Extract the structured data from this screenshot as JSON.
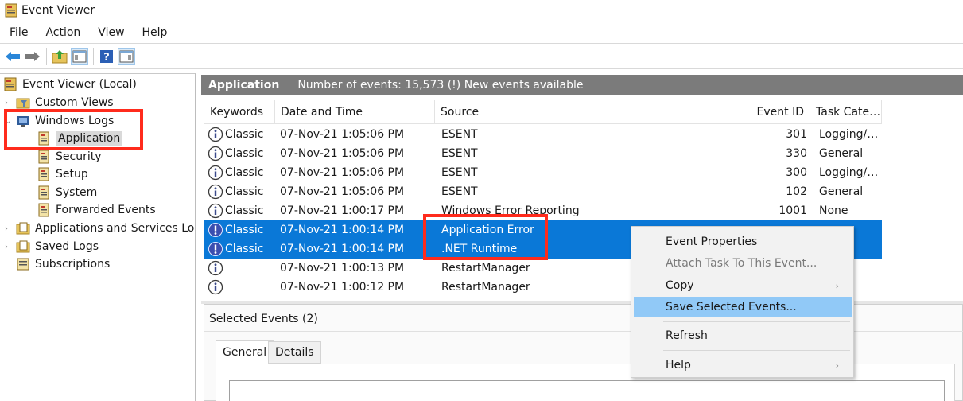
{
  "window": {
    "title": "Event Viewer"
  },
  "menu": [
    "File",
    "Action",
    "View",
    "Help"
  ],
  "toolbar": {
    "buttons": [
      "back-arrow-icon",
      "forward-arrow-icon",
      "folder-up-icon",
      "show-hide-console-tree-icon",
      "help-icon",
      "action-pane-icon"
    ]
  },
  "tree": {
    "root": "Event Viewer (Local)",
    "custom_views": "Custom Views",
    "windows_logs": "Windows Logs",
    "logs": [
      "Application",
      "Security",
      "Setup",
      "System",
      "Forwarded Events"
    ],
    "apps_services": "Applications and Services Logs",
    "saved_logs": "Saved Logs",
    "subscriptions": "Subscriptions"
  },
  "pane": {
    "title": "Application",
    "info": "Number of events: 15,573 (!) New events available"
  },
  "grid": {
    "columns": [
      "Keywords",
      "Date and Time",
      "Source",
      "Event ID",
      "Task Cate…"
    ],
    "rows": [
      {
        "level": "info",
        "keywords": "Classic",
        "datetime": "07-Nov-21 1:05:06 PM",
        "source": "ESENT",
        "event_id": "301",
        "category": "Logging/…",
        "selected": false
      },
      {
        "level": "info",
        "keywords": "Classic",
        "datetime": "07-Nov-21 1:05:06 PM",
        "source": "ESENT",
        "event_id": "330",
        "category": "General",
        "selected": false
      },
      {
        "level": "info",
        "keywords": "Classic",
        "datetime": "07-Nov-21 1:05:06 PM",
        "source": "ESENT",
        "event_id": "300",
        "category": "Logging/…",
        "selected": false
      },
      {
        "level": "info",
        "keywords": "Classic",
        "datetime": "07-Nov-21 1:05:06 PM",
        "source": "ESENT",
        "event_id": "102",
        "category": "General",
        "selected": false
      },
      {
        "level": "info",
        "keywords": "Classic",
        "datetime": "07-Nov-21 1:00:17 PM",
        "source": "Windows Error Reporting",
        "event_id": "1001",
        "category": "None",
        "selected": false
      },
      {
        "level": "error",
        "keywords": "Classic",
        "datetime": "07-Nov-21 1:00:14 PM",
        "source": "Application Error",
        "event_id": "",
        "category": "",
        "selected": true
      },
      {
        "level": "error",
        "keywords": "Classic",
        "datetime": "07-Nov-21 1:00:14 PM",
        "source": ".NET Runtime",
        "event_id": "",
        "category": "",
        "selected": true
      },
      {
        "level": "info",
        "keywords": "",
        "datetime": "07-Nov-21 1:00:13 PM",
        "source": "RestartManager",
        "event_id": "",
        "category": "",
        "selected": false
      },
      {
        "level": "info",
        "keywords": "",
        "datetime": "07-Nov-21 1:00:12 PM",
        "source": "RestartManager",
        "event_id": "",
        "category": "",
        "selected": false
      }
    ]
  },
  "details": {
    "title": "Selected Events (2)",
    "tabs": [
      "General",
      "Details"
    ]
  },
  "context_menu": {
    "items": [
      {
        "label": "Event Properties",
        "disabled": false,
        "submenu": false
      },
      {
        "label": "Attach Task To This Event...",
        "disabled": true,
        "submenu": false
      },
      {
        "label": "Copy",
        "disabled": false,
        "submenu": true
      },
      {
        "label": "Save Selected Events...",
        "disabled": false,
        "submenu": false,
        "hover": true
      },
      {
        "label": "Refresh",
        "disabled": false,
        "submenu": false
      },
      {
        "label": "Help",
        "disabled": false,
        "submenu": true
      }
    ]
  },
  "colors": {
    "selection": "#0a78d7",
    "header_bar": "#7b7b7b",
    "highlight_box": "#ff2b1c",
    "menu_hover": "#91c9f7"
  }
}
